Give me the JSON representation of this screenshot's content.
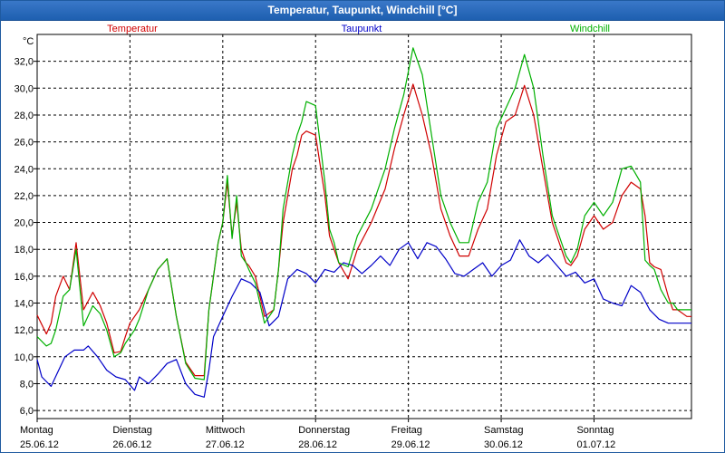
{
  "window": {
    "title": "Temperatur, Taupunkt, Windchill [°C]"
  },
  "chart_data": {
    "type": "line",
    "title": "Temperatur, Taupunkt, Windchill [°C]",
    "ylabel": "°C",
    "ylim": [
      5.4,
      34.0
    ],
    "y_ticks": [
      6.0,
      8.0,
      10.0,
      12.0,
      14.0,
      16.0,
      18.0,
      20.0,
      22.0,
      24.0,
      26.0,
      28.0,
      30.0,
      32.0
    ],
    "y_tick_labels": [
      "6,0",
      "8,0",
      "10,0",
      "12,0",
      "14,0",
      "16,0",
      "18,0",
      "20,0",
      "22,0",
      "24,0",
      "26,0",
      "28,0",
      "30,0",
      "32,0"
    ],
    "xlim": [
      0,
      7.05
    ],
    "categories": [
      {
        "day": "Montag",
        "date": "25.06.12"
      },
      {
        "day": "Dienstag",
        "date": "26.06.12"
      },
      {
        "day": "Mittwoch",
        "date": "27.06.12"
      },
      {
        "day": "Donnerstag",
        "date": "28.06.12"
      },
      {
        "day": "Freitag",
        "date": "29.06.12"
      },
      {
        "day": "Samstag",
        "date": "30.06.12"
      },
      {
        "day": "Sonntag",
        "date": "01.07.12"
      }
    ],
    "grid": true,
    "legend_position": "top",
    "series": [
      {
        "name": "Temperatur",
        "color": "#d00000",
        "x": [
          0.0,
          0.1,
          0.15,
          0.2,
          0.28,
          0.35,
          0.42,
          0.5,
          0.6,
          0.68,
          0.75,
          0.83,
          0.9,
          0.95,
          1.0,
          1.05,
          1.1,
          1.2,
          1.3,
          1.4,
          1.5,
          1.6,
          1.7,
          1.8,
          1.85,
          1.9,
          1.95,
          2.0,
          2.05,
          2.1,
          2.15,
          2.2,
          2.25,
          2.28,
          2.35,
          2.45,
          2.55,
          2.6,
          2.65,
          2.7,
          2.75,
          2.8,
          2.85,
          2.9,
          3.0,
          3.1,
          3.15,
          3.2,
          3.25,
          3.35,
          3.45,
          3.6,
          3.75,
          3.85,
          3.95,
          4.05,
          4.15,
          4.25,
          4.35,
          4.45,
          4.55,
          4.65,
          4.75,
          4.85,
          4.95,
          5.05,
          5.15,
          5.25,
          5.35,
          5.45,
          5.55,
          5.65,
          5.7,
          5.75,
          5.82,
          5.9,
          6.0,
          6.1,
          6.2,
          6.3,
          6.4,
          6.5,
          6.55,
          6.6,
          6.65,
          6.72,
          6.8,
          6.85,
          6.9,
          7.0,
          7.05
        ],
        "values": [
          13.1,
          11.7,
          12.5,
          14.5,
          16.0,
          15.0,
          18.5,
          13.5,
          14.8,
          13.8,
          12.5,
          10.3,
          10.4,
          11.5,
          12.5,
          13.0,
          13.5,
          15.0,
          16.5,
          17.3,
          13.0,
          9.6,
          8.6,
          8.6,
          13.5,
          16.0,
          18.5,
          20.0,
          23.0,
          19.0,
          21.5,
          18.0,
          17.0,
          16.8,
          16.0,
          13.0,
          13.5,
          16.5,
          20.0,
          22.0,
          24.0,
          25.0,
          26.5,
          26.8,
          26.5,
          22.0,
          19.0,
          18.0,
          17.0,
          15.8,
          18.0,
          20.0,
          22.5,
          25.5,
          28.0,
          30.3,
          28.0,
          25.0,
          21.0,
          19.0,
          17.5,
          17.5,
          19.5,
          21.0,
          25.0,
          27.5,
          28.0,
          30.2,
          28.0,
          24.0,
          20.0,
          18.0,
          17.0,
          16.8,
          17.5,
          19.5,
          20.5,
          19.5,
          20.0,
          22.0,
          23.0,
          22.5,
          20.5,
          17.0,
          16.7,
          16.5,
          14.5,
          13.5,
          13.5,
          13.0,
          13.0
        ]
      },
      {
        "name": "Taupunkt",
        "color": "#0000c8",
        "x": [
          0.0,
          0.05,
          0.15,
          0.3,
          0.4,
          0.5,
          0.55,
          0.65,
          0.75,
          0.85,
          0.95,
          1.05,
          1.1,
          1.2,
          1.3,
          1.4,
          1.5,
          1.6,
          1.7,
          1.8,
          1.85,
          1.9,
          2.0,
          2.1,
          2.2,
          2.3,
          2.4,
          2.5,
          2.6,
          2.7,
          2.8,
          2.9,
          3.0,
          3.1,
          3.2,
          3.3,
          3.4,
          3.5,
          3.6,
          3.7,
          3.8,
          3.9,
          4.0,
          4.1,
          4.2,
          4.3,
          4.4,
          4.5,
          4.6,
          4.7,
          4.8,
          4.9,
          5.0,
          5.1,
          5.2,
          5.3,
          5.4,
          5.5,
          5.6,
          5.7,
          5.8,
          5.9,
          6.0,
          6.1,
          6.2,
          6.3,
          6.4,
          6.5,
          6.6,
          6.7,
          6.8,
          6.9,
          7.0,
          7.05
        ],
        "values": [
          9.8,
          8.5,
          7.8,
          10.0,
          10.5,
          10.5,
          10.8,
          10.0,
          9.0,
          8.5,
          8.3,
          7.5,
          8.5,
          8.0,
          8.7,
          9.5,
          9.8,
          8.0,
          7.2,
          7.0,
          9.0,
          11.5,
          13.0,
          14.5,
          15.8,
          15.5,
          14.8,
          12.3,
          13.0,
          15.8,
          16.5,
          16.2,
          15.5,
          16.5,
          16.3,
          17.0,
          16.8,
          16.2,
          16.8,
          17.5,
          16.8,
          18.0,
          18.5,
          17.3,
          18.5,
          18.2,
          17.3,
          16.2,
          16.0,
          16.5,
          17.0,
          16.0,
          16.8,
          17.2,
          18.7,
          17.5,
          17.0,
          17.6,
          16.8,
          16.0,
          16.3,
          15.5,
          15.8,
          14.3,
          14.0,
          13.8,
          15.3,
          14.8,
          13.5,
          12.8,
          12.5,
          12.5,
          12.5,
          12.5
        ]
      },
      {
        "name": "Windchill",
        "color": "#00b000",
        "x": [
          0.0,
          0.1,
          0.15,
          0.2,
          0.28,
          0.35,
          0.42,
          0.5,
          0.6,
          0.68,
          0.75,
          0.83,
          0.9,
          0.95,
          1.0,
          1.05,
          1.1,
          1.2,
          1.3,
          1.4,
          1.5,
          1.6,
          1.7,
          1.8,
          1.85,
          1.9,
          1.95,
          2.0,
          2.05,
          2.1,
          2.15,
          2.2,
          2.25,
          2.28,
          2.35,
          2.45,
          2.55,
          2.6,
          2.65,
          2.7,
          2.75,
          2.8,
          2.85,
          2.9,
          3.0,
          3.1,
          3.15,
          3.2,
          3.25,
          3.35,
          3.45,
          3.6,
          3.75,
          3.85,
          3.95,
          4.05,
          4.15,
          4.25,
          4.35,
          4.45,
          4.55,
          4.65,
          4.75,
          4.85,
          4.95,
          5.05,
          5.15,
          5.25,
          5.35,
          5.45,
          5.55,
          5.65,
          5.7,
          5.75,
          5.82,
          5.9,
          6.0,
          6.1,
          6.2,
          6.3,
          6.4,
          6.5,
          6.55,
          6.6,
          6.65,
          6.72,
          6.8,
          6.85,
          6.9,
          7.0,
          7.05
        ],
        "values": [
          11.5,
          10.8,
          11.0,
          12.0,
          14.5,
          15.0,
          18.0,
          12.3,
          13.8,
          13.2,
          12.0,
          10.0,
          10.3,
          11.0,
          11.5,
          12.0,
          12.8,
          15.0,
          16.5,
          17.3,
          13.0,
          9.5,
          8.4,
          8.3,
          13.5,
          16.0,
          18.5,
          20.0,
          23.5,
          18.8,
          22.0,
          17.5,
          17.0,
          16.5,
          15.5,
          12.5,
          13.5,
          16.5,
          21.0,
          23.0,
          25.0,
          26.5,
          27.5,
          29.0,
          28.7,
          23.0,
          19.5,
          18.5,
          17.0,
          16.7,
          19.0,
          21.0,
          24.0,
          27.0,
          29.5,
          33.0,
          31.0,
          26.5,
          22.0,
          20.0,
          18.5,
          18.5,
          21.5,
          23.0,
          27.0,
          28.5,
          30.0,
          32.5,
          30.0,
          25.0,
          20.5,
          18.5,
          17.5,
          17.0,
          18.0,
          20.5,
          21.5,
          20.5,
          21.5,
          24.0,
          24.2,
          23.0,
          17.2,
          16.8,
          16.5,
          15.0,
          14.0,
          14.0,
          13.5,
          13.5,
          13.5
        ]
      }
    ]
  }
}
